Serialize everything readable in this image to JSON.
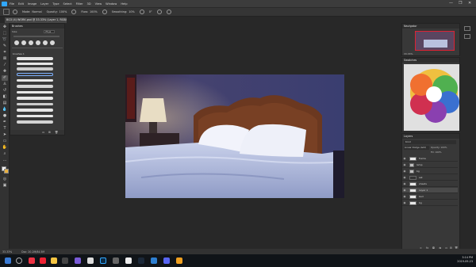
{
  "app": {
    "menu": [
      "File",
      "Edit",
      "Image",
      "Layer",
      "Type",
      "Select",
      "Filter",
      "3D",
      "View",
      "Window",
      "Help"
    ],
    "window_controls": [
      "—",
      "❐",
      "✕"
    ]
  },
  "options_bar": {
    "mode_label": "Mode:",
    "mode_value": "Normal",
    "opacity_label": "Opacity:",
    "opacity_value": "100%",
    "flow_label": "Flow:",
    "flow_value": "100%",
    "smoothing_label": "Smoothing:",
    "smoothing_value": "10%",
    "angle_value": "0°"
  },
  "document": {
    "tab_title": "BG3 (4) WORK.psd @ 33.33% (Layer 1, RGB/8) *"
  },
  "brushes_panel": {
    "title": "Brushes",
    "size_label": "Size:",
    "size_value": "75 px",
    "folder_label": "brushes 1"
  },
  "navigator": {
    "title": "Navigator",
    "zoom": "33.33%"
  },
  "swatches": {
    "title": "Swatches"
  },
  "layers": {
    "title": "Layers",
    "filter_label": "Kind",
    "blend_label": "Linear Dodge (Add)",
    "opacity_label": "Opacity:",
    "opacity_value": "100%",
    "fill_label": "Fill:",
    "fill_value": "100%",
    "rows": [
      {
        "name": "frame",
        "type": "layer"
      },
      {
        "name": "lamp",
        "type": "folder"
      },
      {
        "name": "bg",
        "type": "folder"
      },
      {
        "name": "sat",
        "type": "layer"
      },
      {
        "name": "sheets",
        "type": "layer"
      },
      {
        "name": "Layer 1",
        "type": "layer",
        "selected": true
      },
      {
        "name": "bed",
        "type": "layer"
      },
      {
        "name": "bg",
        "type": "layer"
      }
    ]
  },
  "status_bar": {
    "zoom": "33.33%",
    "doc_info": "Doc: 20.2M/84.5M"
  },
  "taskbar": {
    "time": "3:14 PM",
    "date": "2019-09-23"
  },
  "colors": {
    "accent": "#31a8ff",
    "wall": "#3a3b6a",
    "headboard": "#6b3820",
    "sheets": "#b8c2df"
  }
}
